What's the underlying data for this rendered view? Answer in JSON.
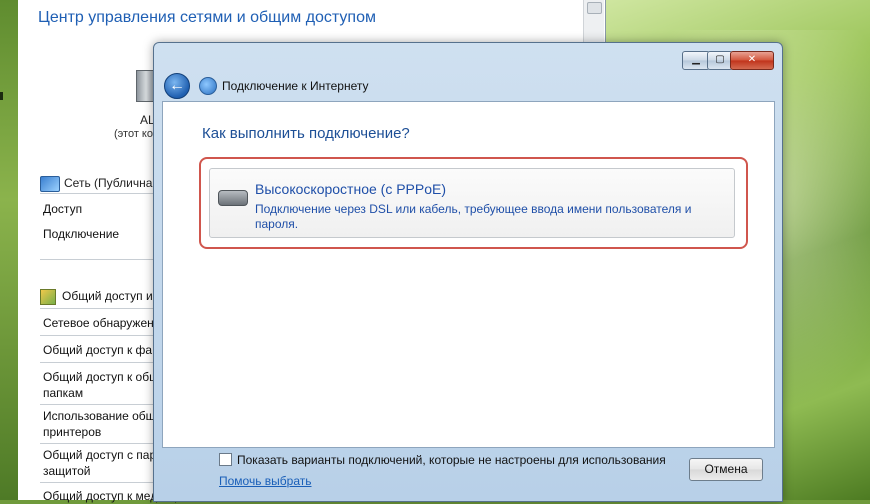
{
  "background_window": {
    "title": "Центр управления сетями и общим доступом",
    "computer_name": "AL",
    "computer_sub": "(этот ко",
    "network_label": "Сеть (Публична",
    "access_label": "Доступ",
    "connection_label": "Подключение",
    "sharing_section": "Общий доступ и",
    "items": [
      "Сетевое обнаружен",
      "Общий доступ к фа",
      "Общий доступ к общ\nпапкам",
      "Использование общ\nпринтеров",
      "Общий доступ с пар\nзащитой",
      "Общий доступ к медиафайлам"
    ]
  },
  "dialog": {
    "title": "Подключение к Интернету",
    "controls": {
      "minimize": "▁",
      "maximize": "▢",
      "close": "✕"
    },
    "back_symbol": "←",
    "question": "Как выполнить подключение?",
    "option": {
      "heading": "Высокоскоростное (с PPPoE)",
      "description": "Подключение через DSL или кабель, требующее ввода имени пользователя и пароля."
    },
    "show_unconfigured_label": "Показать варианты подключений, которые не настроены для использования",
    "help_link": "Помочь выбрать",
    "cancel_button": "Отмена"
  },
  "colors": {
    "accent_text": "#1f4fa8",
    "highlight_outline": "#d0564d"
  }
}
